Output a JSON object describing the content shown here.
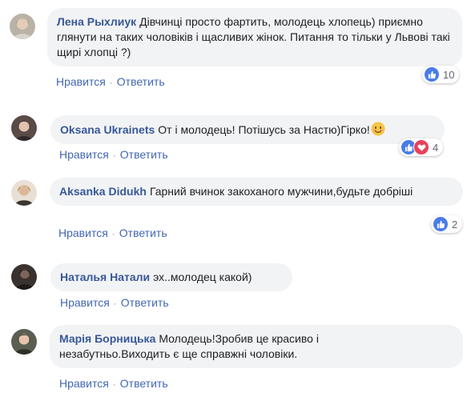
{
  "comments": [
    {
      "author": "Лена Рыхлиук",
      "text": "Дівчинці просто фартить, молодець хлопець) приємно глянути на таких чоловіків і щасливих жінок. Питання то тільки у Львові такі щирі хлопці ?)",
      "like_label": "Нравится",
      "reply_label": "Ответить",
      "reaction_count": "10"
    },
    {
      "author": "Oksana Ukrainets",
      "text": "От і молодець! Потішусь за Настю)Гірко!",
      "like_label": "Нравится",
      "reply_label": "Ответить",
      "reaction_count": "4"
    },
    {
      "author": "Aksanka Didukh",
      "text": "Гарний вчинок закоханого мужчини,будьте добріші",
      "like_label": "Нравится",
      "reply_label": "Ответить",
      "reaction_count": "2"
    },
    {
      "author": "Наталья Натали",
      "text": "эх..молодец какой)",
      "like_label": "Нравится",
      "reply_label": "Ответить"
    },
    {
      "author": "Марія Борницька",
      "text": "Молодець!Зробив це красиво і незабутньо.Виходить є ще справжні чоловіки.",
      "like_label": "Нравится",
      "reply_label": "Ответить"
    }
  ],
  "separator": "·",
  "icons": {
    "like": "thumbs-up-icon",
    "love": "heart-icon",
    "emoji": "smiling-face-icon"
  },
  "colors": {
    "author": "#385898",
    "link": "#4267b2",
    "bubble": "#f2f3f5",
    "like": "#4a7ce8",
    "love": "#e9415b"
  }
}
